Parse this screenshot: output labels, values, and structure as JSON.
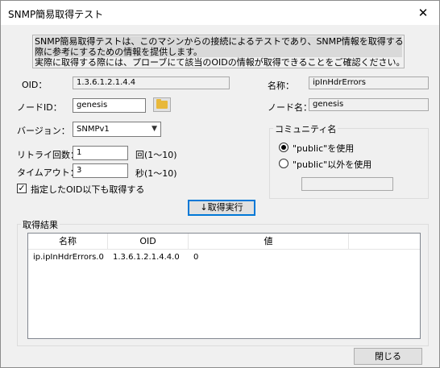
{
  "window": {
    "title": "SNMP簡易取得テスト",
    "close_glyph": "✕"
  },
  "description": {
    "lines": [
      "SNMP簡易取得テストは、このマシンからの接続によるテストであり、SNMP情報を取得する",
      "際に参考にするための情報を提供します。",
      "実際に取得する際には、プローブにて該当のOIDの情報が取得できることをご確認ください。"
    ]
  },
  "form": {
    "oid_label": "OID：",
    "oid_value": "1.3.6.1.2.1.4.4",
    "name_label": "名称：",
    "name_value": "ipInHdrErrors",
    "node_id_label": "ノードID：",
    "node_id_value": "genesis",
    "node_name_label": "ノード名：",
    "node_name_value": "genesis",
    "version_label": "バージョン：",
    "version_value": "SNMPv1",
    "retry_label": "リトライ回数：",
    "retry_value": "1",
    "retry_unit": "回(1〜10)",
    "timeout_label": "タイムアウト：",
    "timeout_value": "3",
    "timeout_unit": "秒(1〜10)",
    "include_below_label": "指定したOID以下も取得する",
    "include_below_checked": true
  },
  "community": {
    "group_title": "コミュニティ名",
    "option_public": "\"public\"を使用",
    "option_other": "\"public\"以外を使用",
    "selected": "public",
    "other_value": ""
  },
  "execute_button": "↓取得実行",
  "results": {
    "group_title": "取得結果",
    "columns": [
      "名称",
      "OID",
      "値"
    ],
    "rows": [
      [
        "ip.ipInHdrErrors.0",
        "1.3.6.1.2.1.4.4.0",
        "0"
      ]
    ]
  },
  "close_button": "閉じる",
  "colors": {
    "accent": "#0078d7",
    "folder": "#e8b83a"
  },
  "icons": {
    "folder_button": "folder-icon",
    "dropdown": "chevron-down-icon",
    "close": "close-icon"
  }
}
